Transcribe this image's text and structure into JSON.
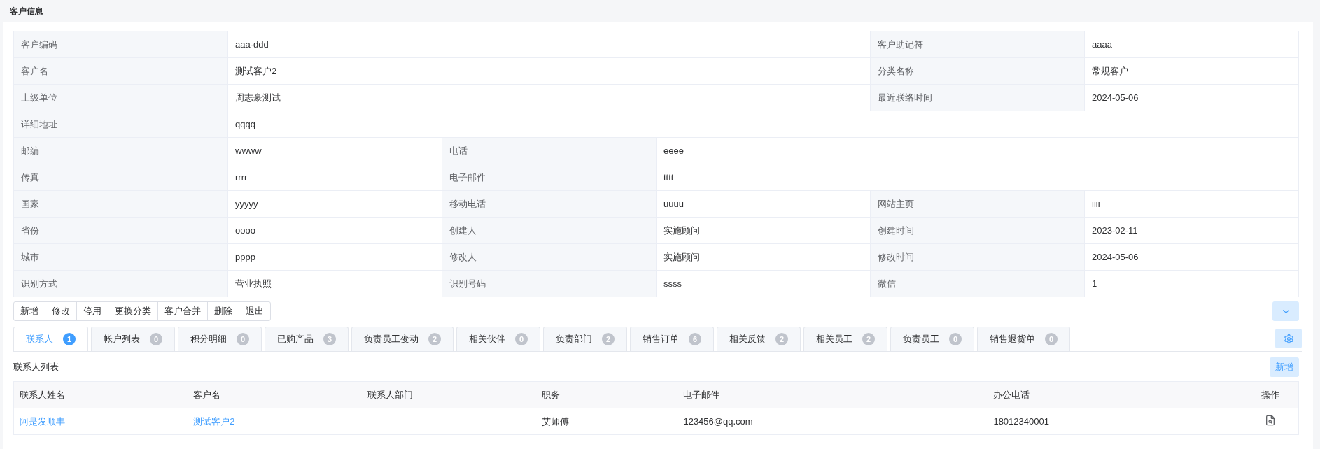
{
  "section_title": "客户信息",
  "details": [
    {
      "kind": "wide_left",
      "fields": [
        {
          "label": "客户编码",
          "value": "aaa-ddd"
        },
        {
          "label": "客户助记符",
          "value": "aaaa"
        }
      ]
    },
    {
      "kind": "wide_left",
      "fields": [
        {
          "label": "客户名",
          "value": "测试客户2"
        },
        {
          "label": "分类名称",
          "value": "常规客户"
        }
      ]
    },
    {
      "kind": "wide_left",
      "fields": [
        {
          "label": "上级单位",
          "value": "周志豪测试"
        },
        {
          "label": "最近联络时间",
          "value": "2024-05-06"
        }
      ]
    },
    {
      "kind": "full",
      "fields": [
        {
          "label": "详细地址",
          "value": "qqqq"
        }
      ]
    },
    {
      "kind": "wide_right",
      "fields": [
        {
          "label": "邮编",
          "value": "wwww"
        },
        {
          "label": "电话",
          "value": "eeee"
        }
      ]
    },
    {
      "kind": "wide_right",
      "fields": [
        {
          "label": "传真",
          "value": "rrrr"
        },
        {
          "label": "电子邮件",
          "value": "tttt"
        }
      ]
    },
    {
      "kind": "triple",
      "fields": [
        {
          "label": "国家",
          "value": "yyyyy"
        },
        {
          "label": "移动电话",
          "value": "uuuu"
        },
        {
          "label": "网站主页",
          "value": "iiii"
        }
      ]
    },
    {
      "kind": "triple",
      "fields": [
        {
          "label": "省份",
          "value": "oooo"
        },
        {
          "label": "创建人",
          "value": "实施顾问"
        },
        {
          "label": "创建时间",
          "value": "2023-02-11"
        }
      ]
    },
    {
      "kind": "triple",
      "fields": [
        {
          "label": "城市",
          "value": "pppp"
        },
        {
          "label": "修改人",
          "value": "实施顾问"
        },
        {
          "label": "修改时间",
          "value": "2024-05-06"
        }
      ]
    },
    {
      "kind": "triple",
      "fields": [
        {
          "label": "识别方式",
          "value": "营业执照"
        },
        {
          "label": "识别号码",
          "value": "ssss"
        },
        {
          "label": "微信",
          "value": "1"
        }
      ]
    }
  ],
  "toolbar": [
    "新增",
    "修改",
    "停用",
    "更换分类",
    "客户合并",
    "删除",
    "退出"
  ],
  "tabs": [
    {
      "label": "联系人",
      "count": "1",
      "selected": true
    },
    {
      "label": "帐户列表",
      "count": "0",
      "selected": false
    },
    {
      "label": "积分明细",
      "count": "0",
      "selected": false
    },
    {
      "label": "已购产品",
      "count": "3",
      "selected": false
    },
    {
      "label": "负责员工变动",
      "count": "2",
      "selected": false
    },
    {
      "label": "相关伙伴",
      "count": "0",
      "selected": false
    },
    {
      "label": "负责部门",
      "count": "2",
      "selected": false
    },
    {
      "label": "销售订单",
      "count": "6",
      "selected": false
    },
    {
      "label": "相关反馈",
      "count": "2",
      "selected": false
    },
    {
      "label": "相关员工",
      "count": "2",
      "selected": false
    },
    {
      "label": "负责员工",
      "count": "0",
      "selected": false
    },
    {
      "label": "销售退货单",
      "count": "0",
      "selected": false
    }
  ],
  "list_title": "联系人列表",
  "add_button": "新增",
  "table": {
    "columns": [
      "联系人姓名",
      "客户名",
      "联系人部门",
      "职务",
      "电子邮件",
      "办公电话",
      "操作"
    ],
    "rows": [
      {
        "cells": [
          "阿是发顺丰",
          "测试客户2",
          "",
          "艾师傅",
          "123456@qq.com",
          "18012340001"
        ]
      }
    ]
  }
}
